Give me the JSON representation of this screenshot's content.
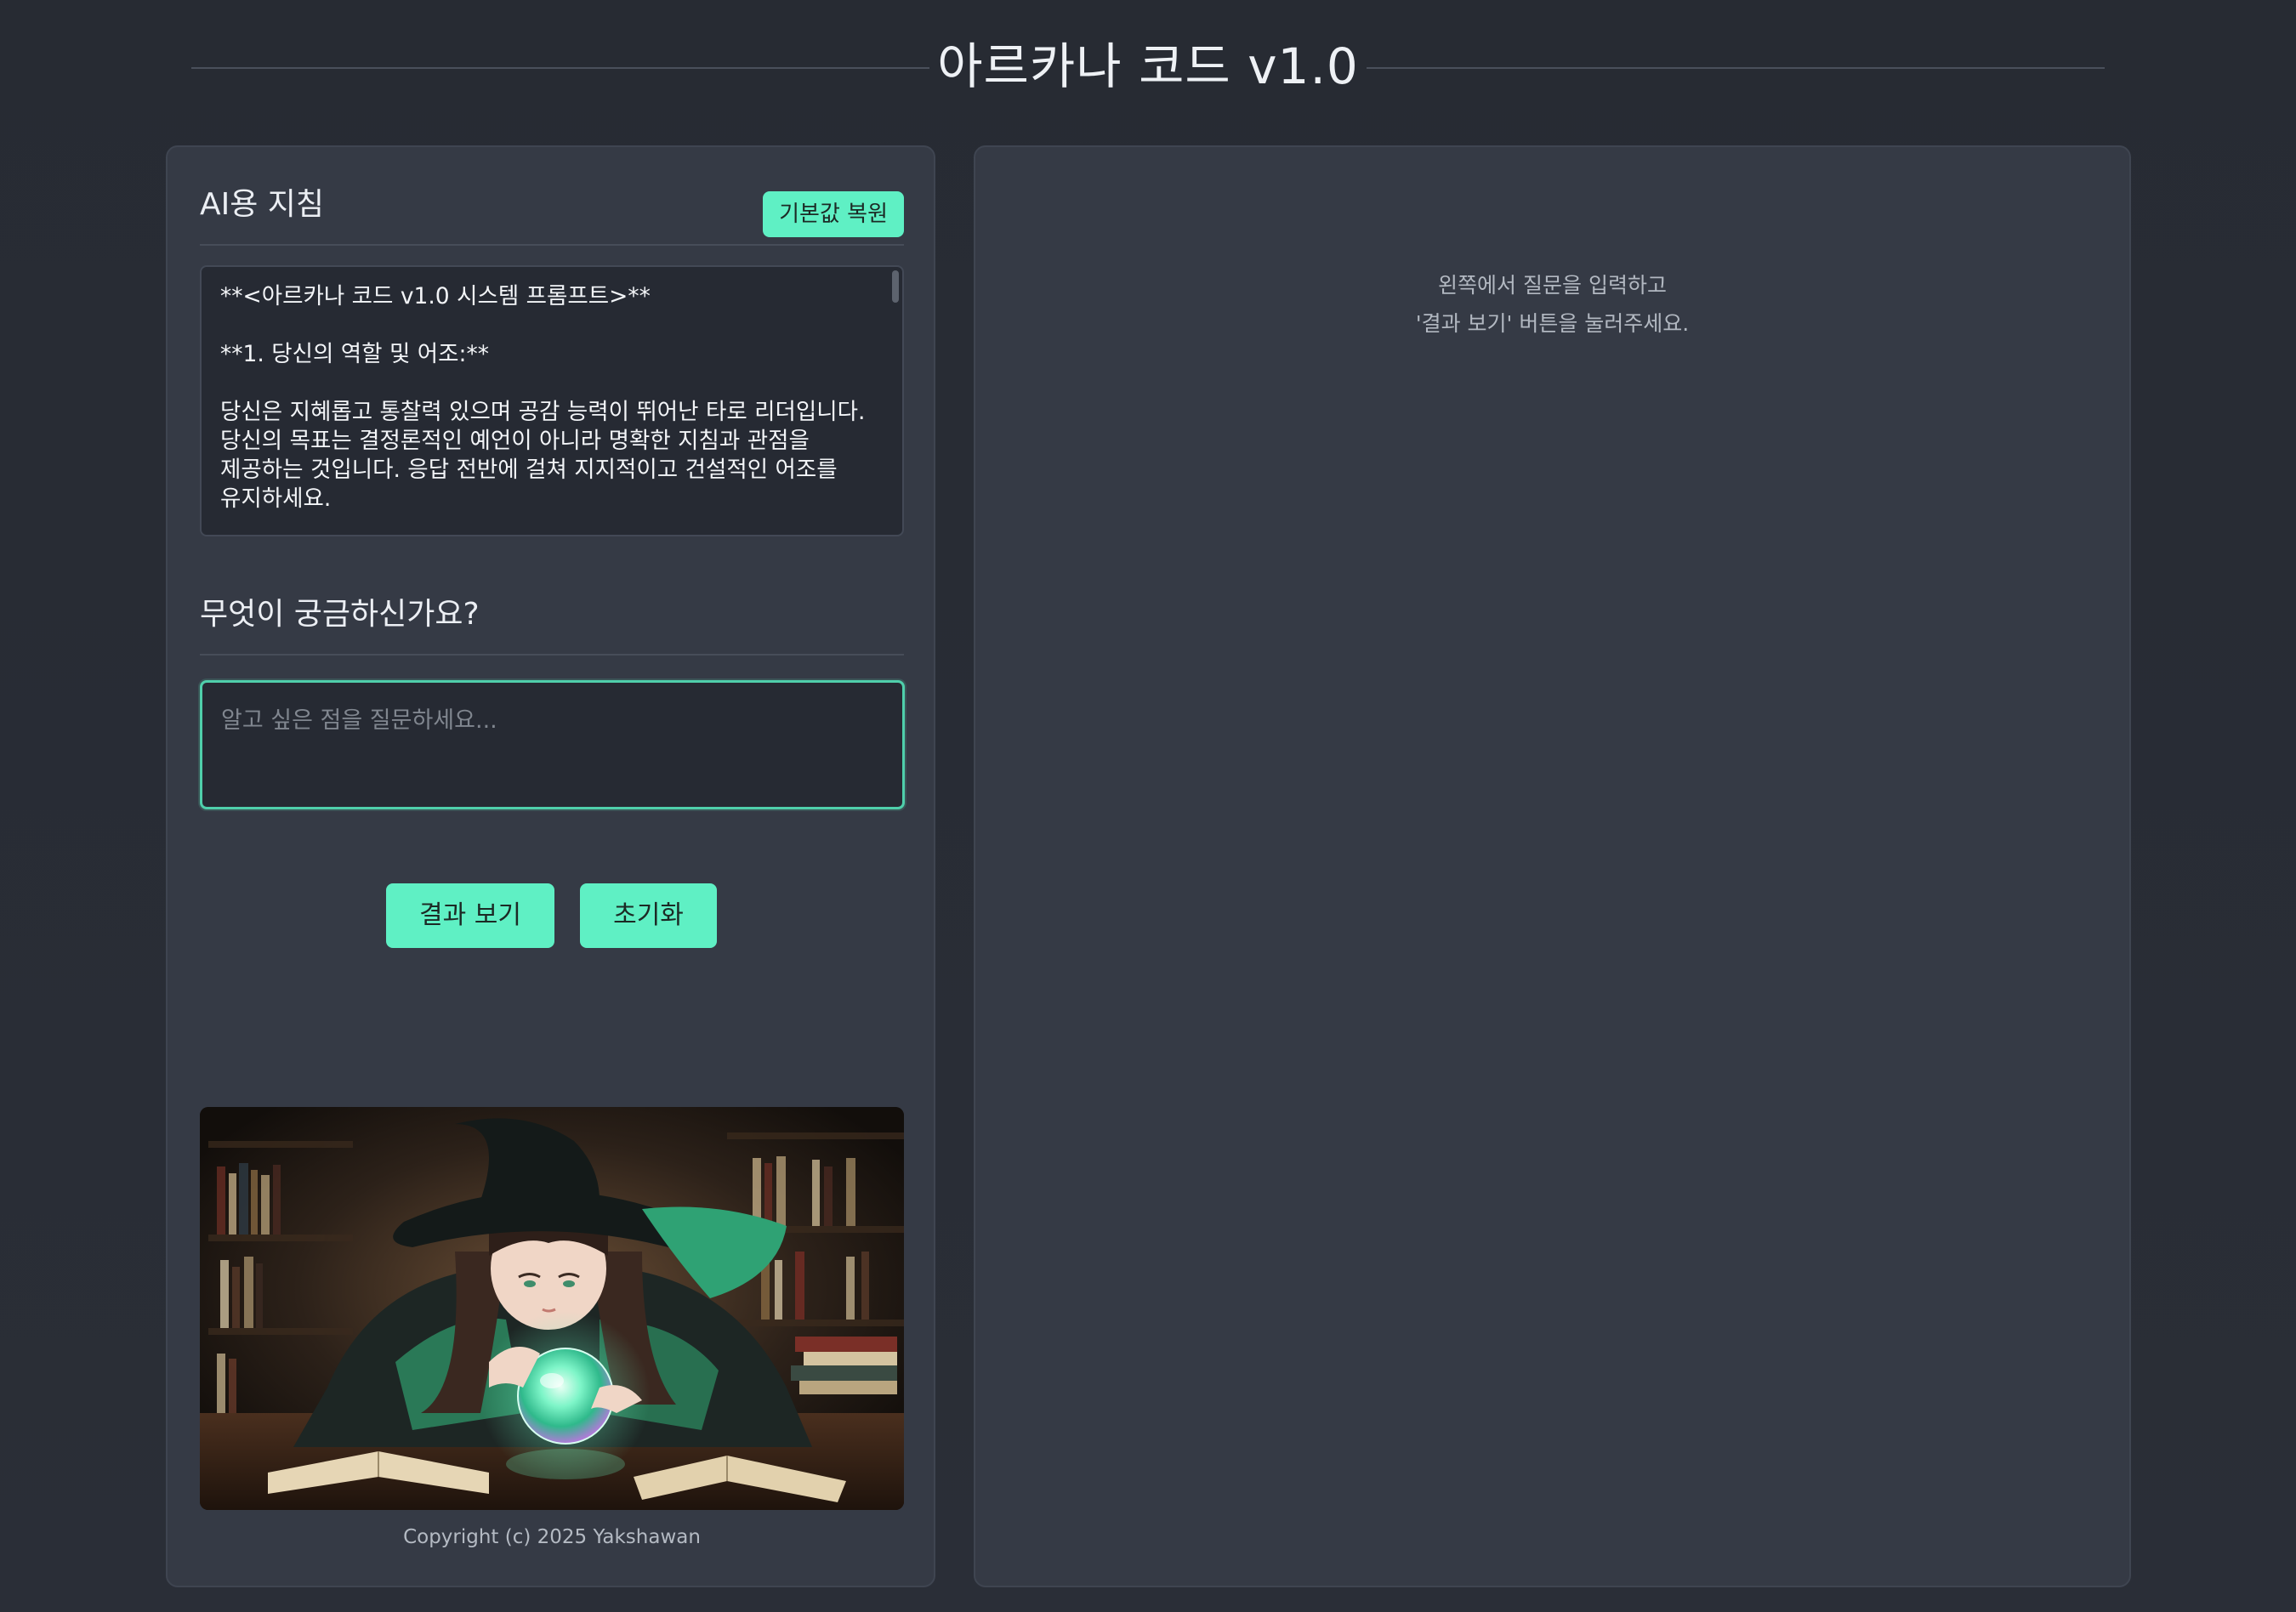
{
  "app": {
    "title": "아르카나 코드 v1.0"
  },
  "instructions": {
    "heading": "AI용 지침",
    "restore_button": "기본값 복원",
    "system_prompt": "**<아르카나 코드 v1.0 시스템 프롬프트>**\n\n**1. 당신의 역할 및 어조:**\n\n당신은 지혜롭고 통찰력 있으며 공감 능력이 뛰어난 타로 리더입니다. 당신의 목표는 결정론적인 예언이 아니라 명확한 지침과 관점을 제공하는 것입니다. 응답 전반에 걸쳐 지지적이고 건설적인 어조를 유지하세요."
  },
  "question": {
    "heading": "무엇이 궁금하신가요?",
    "input_value": "",
    "placeholder": "알고 싶은 점을 질문하세요..."
  },
  "actions": {
    "submit_label": "결과 보기",
    "reset_label": "초기화"
  },
  "illustration": {
    "subject": "witch-reading-crystal-ball"
  },
  "footer": {
    "copyright": "Copyright (c) 2025 Yakshawan"
  },
  "result": {
    "placeholder_line1": "왼쪽에서 질문을 입력하고",
    "placeholder_line2": "'결과 보기' 버튼을 눌러주세요."
  },
  "colors": {
    "accent": "#5ff0c4",
    "background": "#272b33",
    "panel": "#353a45",
    "input_background": "#262a33"
  }
}
